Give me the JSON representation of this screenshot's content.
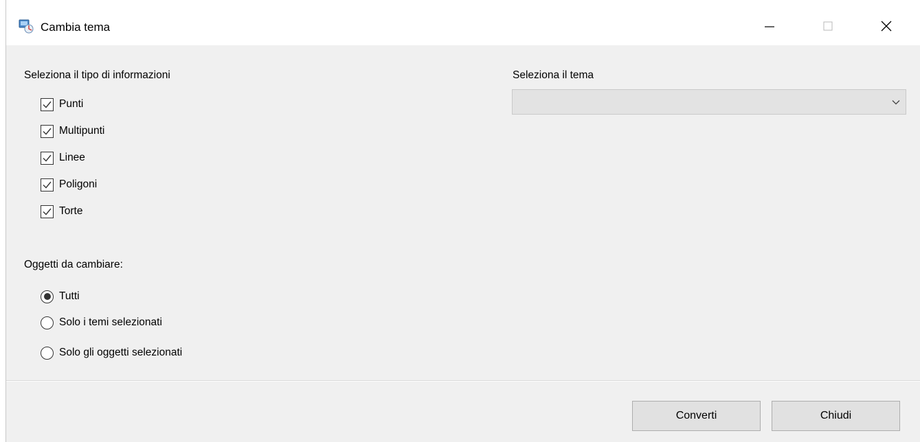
{
  "window": {
    "title": "Cambia tema"
  },
  "left": {
    "types_label": "Seleziona il tipo di informazioni",
    "types": [
      {
        "label": "Punti",
        "checked": true
      },
      {
        "label": "Multipunti",
        "checked": true
      },
      {
        "label": "Linee",
        "checked": true
      },
      {
        "label": "Poligoni",
        "checked": true
      },
      {
        "label": "Torte",
        "checked": true
      }
    ],
    "objects_label": "Oggetti da cambiare:",
    "objects": [
      {
        "label": "Tutti",
        "selected": true
      },
      {
        "label": "Solo i temi selezionati",
        "selected": false
      },
      {
        "label": "Solo gli oggetti selezionati",
        "selected": false
      }
    ]
  },
  "right": {
    "theme_label": "Seleziona il tema",
    "theme_value": ""
  },
  "buttons": {
    "convert": "Converti",
    "close": "Chiudi"
  }
}
